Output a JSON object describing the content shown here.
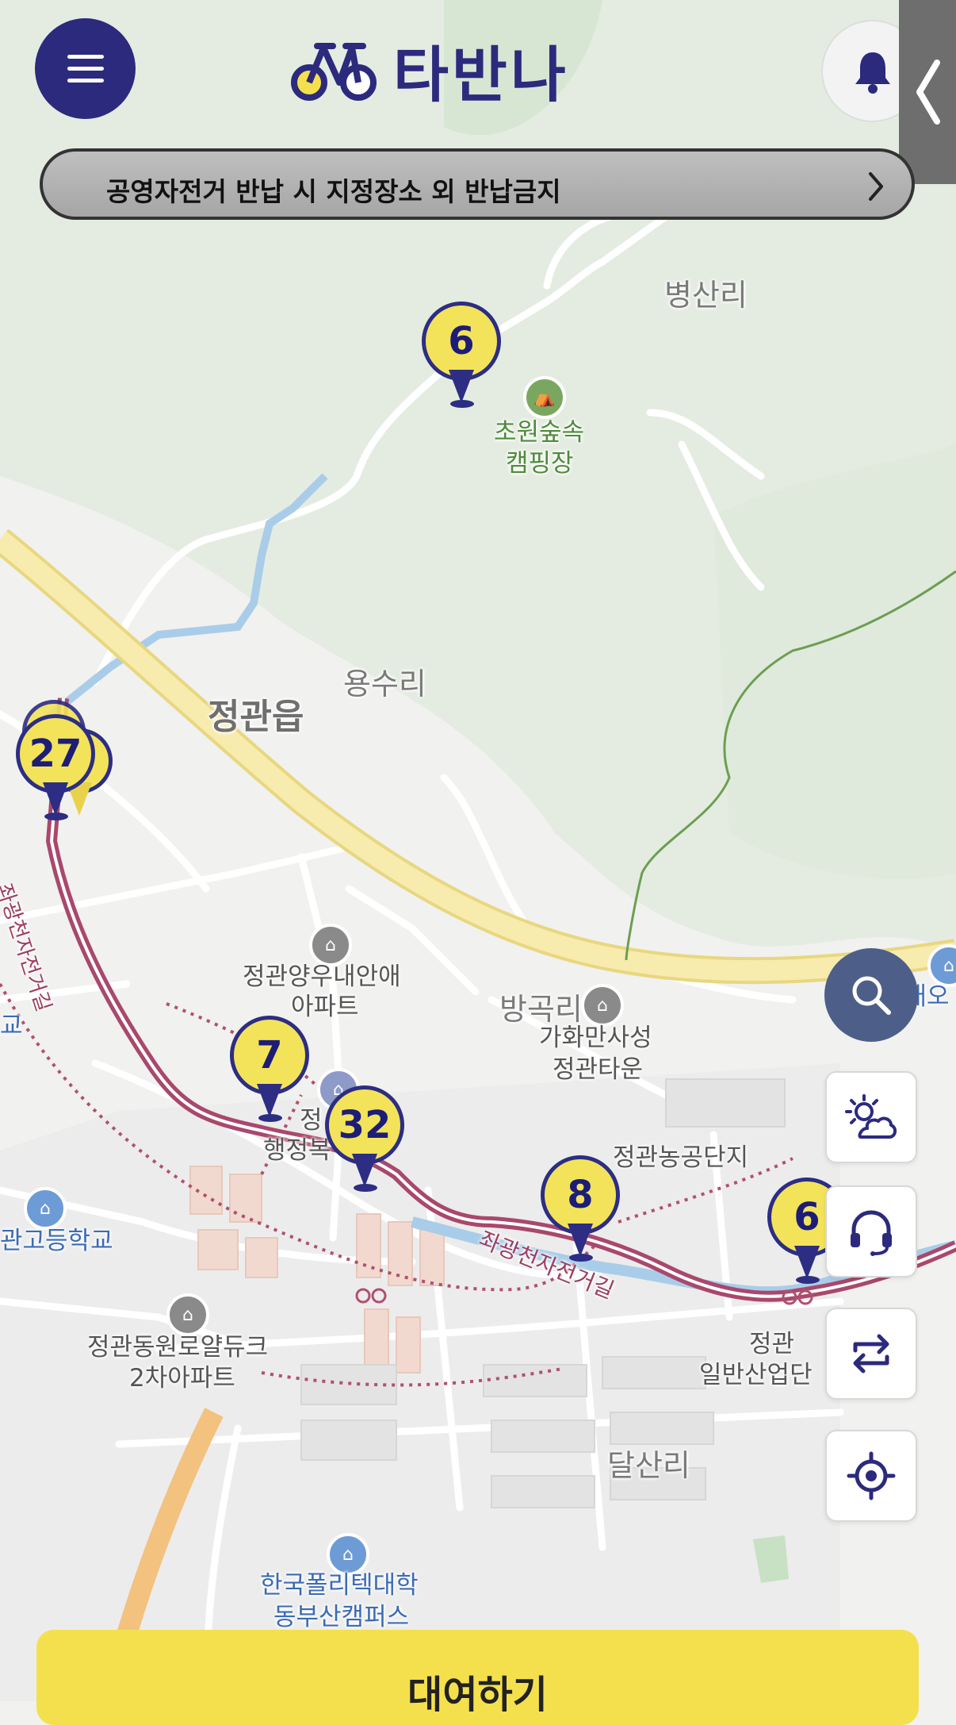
{
  "header": {
    "logo_text": "타반나",
    "notice": "공영자전거 반납 시 지정장소 외 반납금지"
  },
  "map_labels": {
    "byeongsan": "병산리",
    "campsite_1": "초원숲속",
    "campsite_2": "캠핑장",
    "yongsu": "용수리",
    "jeonggwan_eup": "정관읍",
    "apt_woonae_1": "정관양우내안애",
    "apt_woonae_2": "아파트",
    "banggok": "방곡리",
    "gahwa_1": "가화만사성",
    "gahwa_2": "정관타운",
    "jeonggwan_office_1": "정",
    "jeonggwan_office_2": "행정복",
    "agri_complex": "정관농공단지",
    "highschool": "관고등학교",
    "left_edge": "교",
    "dongwon_1": "정관동원로얄듀크",
    "dongwon_2": "2차아파트",
    "industrial_1": "정관",
    "industrial_2": "일반산업단",
    "dalsan": "달산리",
    "polytech_1": "한국폴리텍대학",
    "polytech_2": "동부산캠퍼스",
    "hyundai_oil": "현대오",
    "bike_road_1": "좌광천자전거길",
    "bike_road_2": "좌광천자전거길"
  },
  "stations": [
    {
      "count": "6"
    },
    {
      "count": "27"
    },
    {
      "count": "7"
    },
    {
      "count": "32"
    },
    {
      "count": "8"
    },
    {
      "count": "6"
    }
  ],
  "controls": {
    "rent_button": "대여하기"
  },
  "colors": {
    "brand_navy": "#2c2a7d",
    "pin_yellow": "#f3e35a",
    "rent_yellow": "#f4e04d",
    "bike_route": "#b0506f",
    "highway": "#f7e7a3",
    "river": "#a9cde9"
  },
  "icons": [
    "menu-icon",
    "bike-logo-icon",
    "bell-icon",
    "chevron-left-icon",
    "chevron-right-icon",
    "search-icon",
    "weather-icon",
    "headset-icon",
    "swap-icon",
    "location-target-icon",
    "campsite-icon",
    "apartment-icon",
    "school-icon",
    "university-icon"
  ]
}
